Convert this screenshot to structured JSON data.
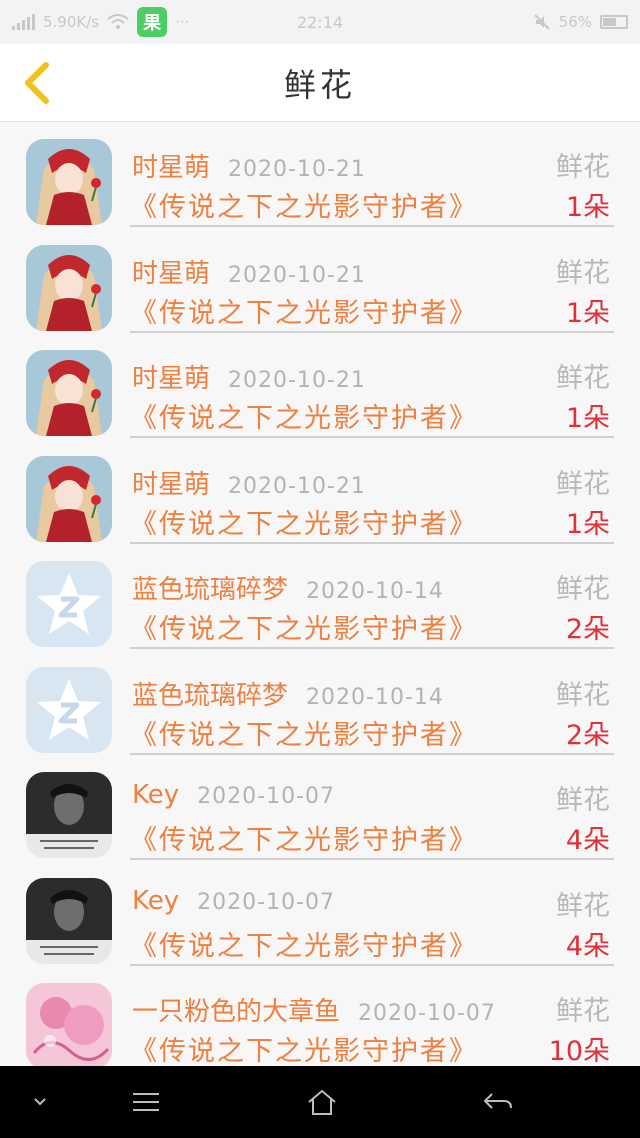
{
  "status_bar": {
    "network_speed": "5.90K/s",
    "time": "22:14",
    "battery": "56%",
    "app_badge_icon": "green-app-icon"
  },
  "header": {
    "title": "鲜花",
    "back_icon": "chevron-left-icon"
  },
  "colors": {
    "accent": "#ee8040",
    "count": "#e0303a",
    "muted": "#b3b3b3",
    "back_icon": "#f0c21a"
  },
  "list": [
    {
      "user": "时星萌",
      "date": "2020-10-21",
      "title": "《传说之下之光影守护者》",
      "flower_label": "鲜花",
      "count": "1朵",
      "avatar": "anime-girl-avatar"
    },
    {
      "user": "时星萌",
      "date": "2020-10-21",
      "title": "《传说之下之光影守护者》",
      "flower_label": "鲜花",
      "count": "1朵",
      "avatar": "anime-girl-avatar"
    },
    {
      "user": "时星萌",
      "date": "2020-10-21",
      "title": "《传说之下之光影守护者》",
      "flower_label": "鲜花",
      "count": "1朵",
      "avatar": "anime-girl-avatar"
    },
    {
      "user": "时星萌",
      "date": "2020-10-21",
      "title": "《传说之下之光影守护者》",
      "flower_label": "鲜花",
      "count": "1朵",
      "avatar": "anime-girl-avatar"
    },
    {
      "user": "蓝色琉璃碎梦",
      "date": "2020-10-14",
      "title": "《传说之下之光影守护者》",
      "flower_label": "鲜花",
      "count": "2朵",
      "avatar": "qq-star-avatar"
    },
    {
      "user": "蓝色琉璃碎梦",
      "date": "2020-10-14",
      "title": "《传说之下之光影守护者》",
      "flower_label": "鲜花",
      "count": "2朵",
      "avatar": "qq-star-avatar"
    },
    {
      "user": "Key",
      "date": "2020-10-07",
      "title": "《传说之下之光影守护者》",
      "flower_label": "鲜花",
      "count": "4朵",
      "avatar": "bw-portrait-avatar"
    },
    {
      "user": "Key",
      "date": "2020-10-07",
      "title": "《传说之下之光影守护者》",
      "flower_label": "鲜花",
      "count": "4朵",
      "avatar": "bw-portrait-avatar"
    },
    {
      "user": "一只粉色的大章鱼",
      "date": "2020-10-07",
      "title": "《传说之下之光影守护者》",
      "flower_label": "鲜花",
      "count": "10朵",
      "avatar": "pink-art-avatar"
    }
  ],
  "nav": {
    "items": [
      "chevron-down-icon",
      "menu-icon",
      "home-icon",
      "back-arrow-icon"
    ]
  }
}
